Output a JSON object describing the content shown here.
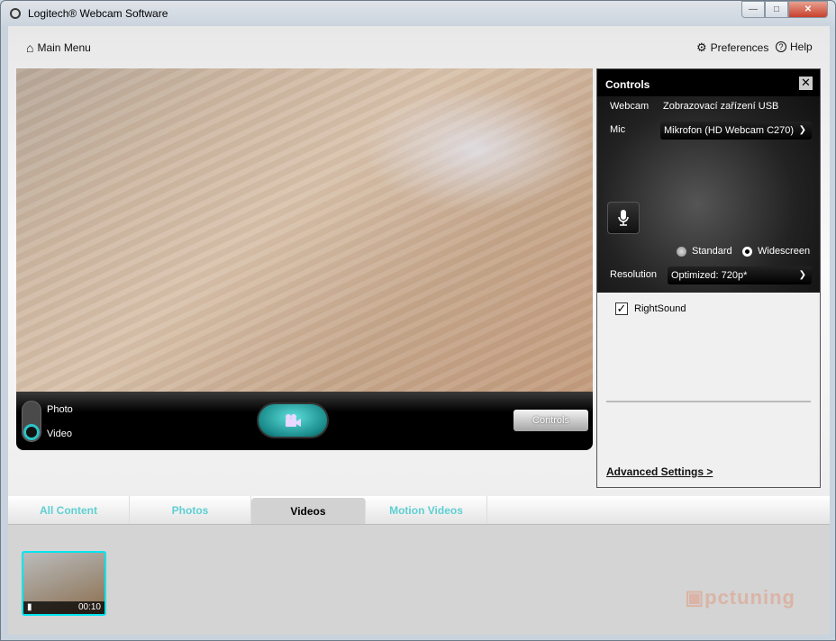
{
  "window": {
    "title": "Logitech® Webcam Software",
    "controls": [
      "minimize",
      "maximize",
      "close"
    ]
  },
  "nav": {
    "main_menu": "Main Menu",
    "preferences": "Preferences",
    "help": "Help"
  },
  "capture_bar": {
    "mode_photo": "Photo",
    "mode_video": "Video",
    "selected_mode": "Video",
    "capture_icon": "video-camera-icon",
    "controls_button": "Controls"
  },
  "controls_panel": {
    "title": "Controls",
    "webcam_label": "Webcam",
    "webcam_value": "Zobrazovací zařízení USB",
    "mic_label": "Mic",
    "mic_value": "Mikrofon (HD Webcam C270)",
    "aspect_standard": "Standard",
    "aspect_widescreen": "Widescreen",
    "aspect_selected": "Widescreen",
    "resolution_label": "Resolution",
    "resolution_value": "Optimized: 720p*",
    "rightsound_label": "RightSound",
    "rightsound_checked": true,
    "advanced_link": "Advanced Settings >"
  },
  "tabs": [
    {
      "label": "All Content"
    },
    {
      "label": "Photos"
    },
    {
      "label": "Videos",
      "active": true
    },
    {
      "label": "Motion Videos"
    }
  ],
  "gallery": {
    "items": [
      {
        "type": "video",
        "duration": "00:10"
      }
    ]
  },
  "watermark": "pctuning",
  "colors": {
    "accent": "#2cc3c6",
    "tab_inactive": "#5ecfd3",
    "thumb_border": "#00e5ef"
  }
}
